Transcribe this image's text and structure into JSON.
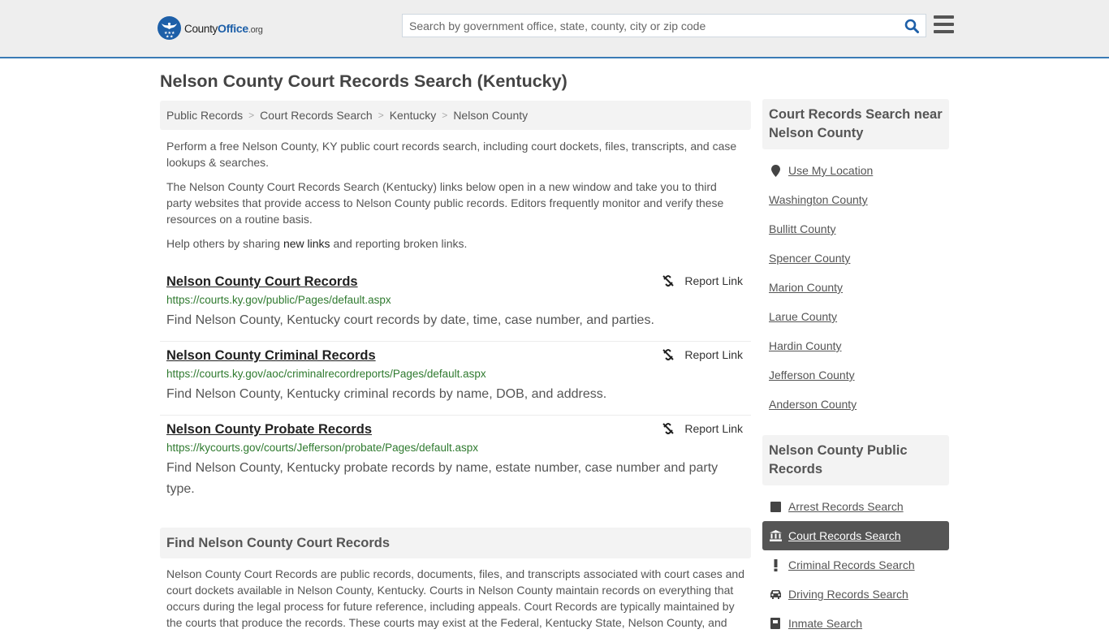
{
  "header": {
    "logo": {
      "name_prefix": "County",
      "name_brand": "Office",
      "name_suffix": ".org"
    },
    "search": {
      "placeholder": "Search by government office, state, county, city or zip code",
      "value": ""
    },
    "icons": {
      "search": "search-icon",
      "menu": "hamburger-menu-icon"
    }
  },
  "page": {
    "title": "Nelson County Court Records Search (Kentucky)"
  },
  "breadcrumb": [
    {
      "label": "Public Records"
    },
    {
      "label": "Court Records Search"
    },
    {
      "label": "Kentucky"
    },
    {
      "label": "Nelson County"
    }
  ],
  "breadcrumb_separator": ">",
  "intro": {
    "p1": "Perform a free Nelson County, KY public court records search, including court dockets, files, transcripts, and case lookups & searches.",
    "p2": "The Nelson County Court Records Search (Kentucky) links below open in a new window and take you to third party websites that provide access to Nelson County public records. Editors frequently monitor and verify these resources on a routine basis.",
    "p3_before": "Help others by sharing ",
    "p3_link": "new links",
    "p3_after": " and reporting broken links."
  },
  "records": [
    {
      "title": "Nelson County Court Records",
      "url": "https://courts.ky.gov/public/Pages/default.aspx",
      "description": "Find Nelson County, Kentucky court records by date, time, case number, and parties.",
      "report_label": "Report Link"
    },
    {
      "title": "Nelson County Criminal Records",
      "url": "https://courts.ky.gov/aoc/criminalrecordreports/Pages/default.aspx",
      "description": "Find Nelson County, Kentucky criminal records by name, DOB, and address.",
      "report_label": "Report Link"
    },
    {
      "title": "Nelson County Probate Records",
      "url": "https://kycourts.gov/courts/Jefferson/probate/Pages/default.aspx",
      "description": "Find Nelson County, Kentucky probate records by name, estate number, case number and party type.",
      "report_label": "Report Link"
    }
  ],
  "find_section": {
    "heading": "Find Nelson County Court Records",
    "body": "Nelson County Court Records are public records, documents, files, and transcripts associated with court cases and court dockets available in Nelson County, Kentucky. Courts in Nelson County maintain records on everything that occurs during the legal process for future reference, including appeals. Court Records are typically maintained by the courts that produce the records. These courts may exist at the Federal, Kentucky State, Nelson County, and"
  },
  "sidebar": {
    "near": {
      "heading": "Court Records Search near Nelson County",
      "use_location": "Use My Location",
      "counties": [
        "Washington County",
        "Bullitt County",
        "Spencer County",
        "Marion County",
        "Larue County",
        "Hardin County",
        "Jefferson County",
        "Anderson County"
      ]
    },
    "public_records": {
      "heading": "Nelson County Public Records",
      "items": [
        {
          "label": "Arrest Records Search",
          "icon": "square-icon",
          "active": false
        },
        {
          "label": "Court Records Search",
          "icon": "courthouse-icon",
          "active": true
        },
        {
          "label": "Criminal Records Search",
          "icon": "exclamation-icon",
          "active": false
        },
        {
          "label": "Driving Records Search",
          "icon": "car-icon",
          "active": false
        },
        {
          "label": "Inmate Search",
          "icon": "inmate-icon",
          "active": false
        }
      ]
    }
  },
  "colors": {
    "accent_blue": "#1d5fa8",
    "header_border": "#3a7bb5",
    "url_green": "#2f7a2f",
    "active_item_bg": "#555555"
  }
}
